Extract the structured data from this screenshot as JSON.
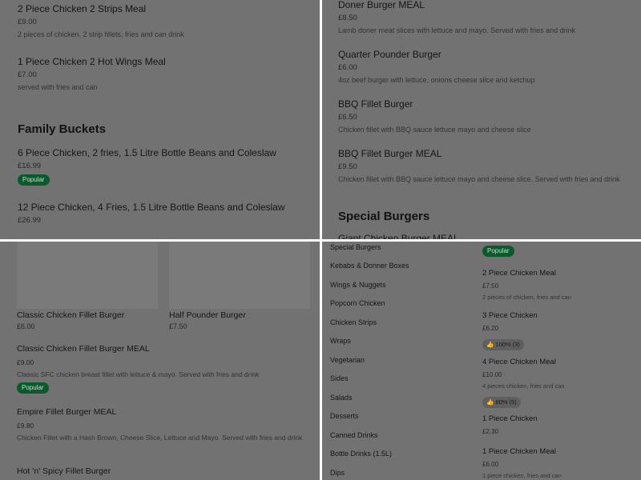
{
  "panel1": {
    "items": [
      {
        "name": "2 Piece Chicken 2 Strips Meal",
        "price": "£9.00",
        "desc": "2 pieces of chicken, 2 strip fillets, fries and can drink"
      },
      {
        "name": "1 Piece Chicken 2 Hot Wings Meal",
        "price": "£7.00",
        "desc": "served with fries and can"
      }
    ],
    "section_title": "Family Buckets",
    "bucket_items": [
      {
        "name": "6 Piece Chicken, 2 fries, 1.5 Litre Bottle Beans and Coleslaw",
        "price": "£16.99",
        "badge": "Popular"
      },
      {
        "name": "12 Piece Chicken, 4 Fries, 1.5 Litre Bottle Beans and Coleslaw",
        "price": "£26.99"
      }
    ]
  },
  "panel2": {
    "items": [
      {
        "name": "Doner Burger MEAL",
        "price": "£8.50",
        "desc": "Lamb doner meat slices with lettuce and mayo. Served with fries and drink"
      },
      {
        "name": "Quarter Pounder Burger",
        "price": "£6.00",
        "desc": "4oz beef burger with lettuce, onions cheese slice and ketchup"
      },
      {
        "name": "BBQ Fillet Burger",
        "price": "£6.50",
        "desc": "Chicken fillet with BBQ sauce lettuce mayo and cheese slice"
      },
      {
        "name": "BBQ Fillet Burger MEAL",
        "price": "£9.50",
        "desc": "Chicken fillet with BBQ sauce lettuce mayo and cheese slice. Served with fries and drink"
      }
    ],
    "section_title": "Special Burgers",
    "partial_item": "Giant Chicken Burger MEAL"
  },
  "panel3": {
    "cards": [
      {
        "name": "Classic Chicken Fillet Burger",
        "price": "£6.00"
      },
      {
        "name": "Half Pounder Burger",
        "price": "£7.50"
      }
    ],
    "items": [
      {
        "name": "Classic Chicken Fillet Burger MEAL",
        "price": "£9.00",
        "desc": "Classic SFC chicken breast fillet with lettuce & mayo. Served with fries and drink",
        "badge": "Popular"
      },
      {
        "name": "Empire Fillet Burger MEAL",
        "price": "£9.80",
        "desc": "Chicken Fillet with a Hash Brown, Cheese Slice, Lettuce and Mayo. Served with fries and drink"
      },
      {
        "name": "Hot 'n' Spicy Fillet Burger"
      }
    ]
  },
  "panel4": {
    "categories": [
      "Special Burgers",
      "Kebabs & Donner Boxes",
      "Wings & Nuggets",
      "Popcorn Chicken",
      "Chicken Strips",
      "Wraps",
      "Vegetarian",
      "Sides",
      "Salads",
      "Desserts",
      "Canned Drinks",
      "Bottle Drinks (1.5L)",
      "Dips"
    ],
    "top_badge": "Popular",
    "items": [
      {
        "name": "2 Piece Chicken Meal",
        "price": "£7.50",
        "desc": "2 pieces of chicken, fries and can"
      },
      {
        "name": "3 Piece Chicken",
        "price": "£6.20",
        "rating": "100% (3)"
      },
      {
        "name": "4 Piece Chicken Meal",
        "price": "£10.00",
        "desc": "4 pieces chicken, fries and can",
        "rating": "80% (5)"
      },
      {
        "name": "1 Piece Chicken",
        "price": "£2.30"
      },
      {
        "name": "1 Piece Chicken Meal",
        "price": "£6.00",
        "desc": "1 piece chicken, fries and can"
      }
    ]
  }
}
